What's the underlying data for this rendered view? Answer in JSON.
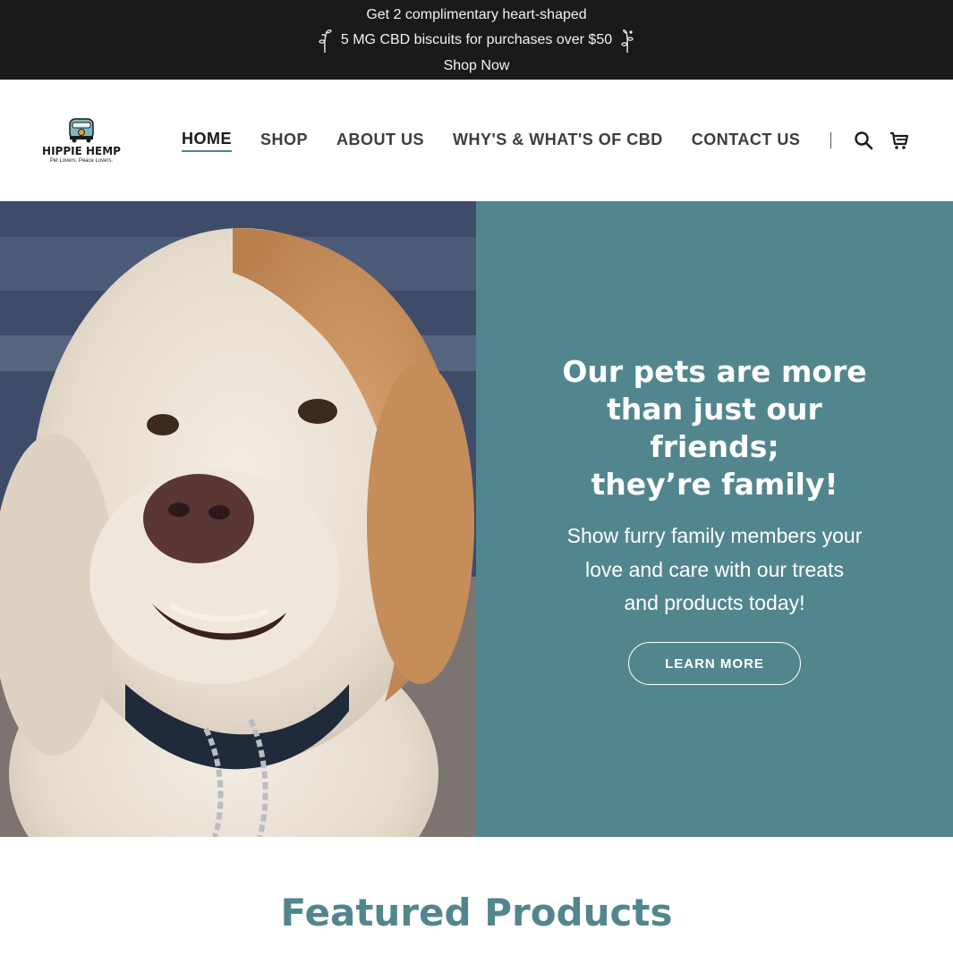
{
  "announcement": {
    "line1": "Get 2 complimentary heart-shaped",
    "line2": "5 MG CBD biscuits for purchases over $50",
    "link": "Shop Now",
    "icon": "sprig-icon"
  },
  "header": {
    "logo": {
      "title": "HIPPIE HEMP",
      "tagline": "Pet Lovers. Peace Lovers."
    },
    "nav": [
      {
        "label": "HOME",
        "active": true
      },
      {
        "label": "SHOP"
      },
      {
        "label": "ABOUT US"
      },
      {
        "label": "WHY'S & WHAT'S OF CBD"
      },
      {
        "label": "CONTACT US"
      }
    ],
    "icons": [
      "search-icon",
      "cart-icon"
    ]
  },
  "hero": {
    "title_lines": [
      "Our pets are more",
      "than just our",
      "friends;",
      "they’re family!"
    ],
    "subtitle": "Show furry family members your love and care with our treats and products today!",
    "button": "LEARN MORE",
    "panel_color": "#52868e"
  },
  "featured": {
    "title": "Featured Products"
  }
}
